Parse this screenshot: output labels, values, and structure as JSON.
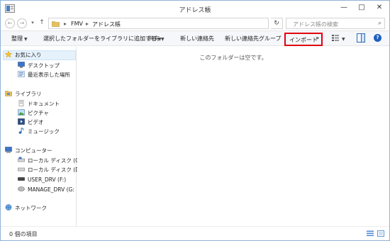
{
  "window": {
    "title": "アドレス帳",
    "minimize_label": "—",
    "maximize_label": "□",
    "close_label": "✕"
  },
  "address": {
    "back_label": "←",
    "forward_label": "→",
    "history_label": "▾",
    "up_label": "↑",
    "separator": "▸",
    "crumbs": [
      "FMV",
      "アドレス帳"
    ],
    "dropdown_label": "▾",
    "refresh_label": "↻",
    "search_placeholder": "アドレス帳の検索",
    "search_icon_glyph": "⌕"
  },
  "commandbar": {
    "organize": "整理",
    "include_in_library": "選択したフォルダーをライブラリに追加する",
    "share": "共有",
    "new_contact": "新しい連絡先",
    "new_contact_group": "新しい連絡先グループ",
    "import": "インポート",
    "more": "»",
    "caret": "▼",
    "help": "?",
    "highlight_color": "#e00010"
  },
  "nav": {
    "favorites": "お気に入り",
    "desktop": "デスクトップ",
    "recent": "最近表示した場所",
    "libraries": "ライブラリ",
    "documents": "ドキュメント",
    "pictures": "ピクチャ",
    "videos": "ビデオ",
    "music": "ミュージック",
    "computer": "コンピューター",
    "drive_c": "ローカル ディスク (C:)",
    "drive_d": "ローカル ディスク (D:)",
    "drive_f": "USER_DRV (F:)",
    "drive_g": "MANAGE_DRV (G:",
    "network": "ネットワーク"
  },
  "content": {
    "empty_message": "このフォルダーは空です。"
  },
  "status": {
    "item_count": "0 個の項目"
  },
  "icons": {
    "app": "address-book-icon",
    "star": "star-icon",
    "folder": "folder-icon"
  }
}
